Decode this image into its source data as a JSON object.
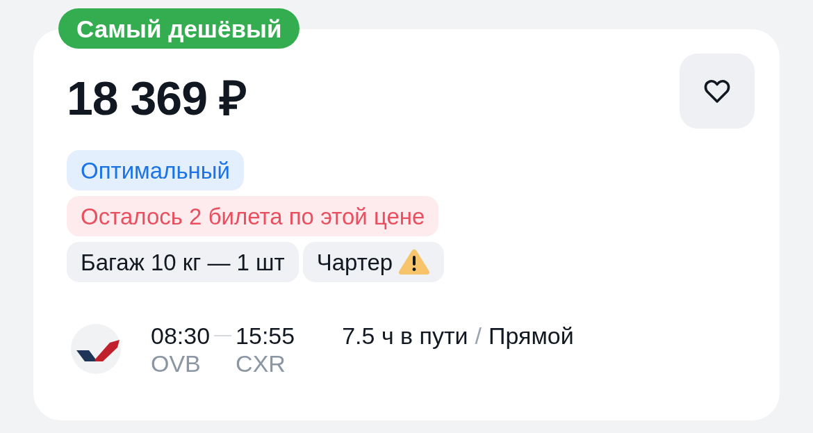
{
  "badge": {
    "text": "Самый дешёвый"
  },
  "price": "18 369 ₽",
  "favorite_button": {
    "favorited": false
  },
  "tag_rows": [
    [
      {
        "kind": "info",
        "text": "Оптимальный"
      }
    ],
    [
      {
        "kind": "alert",
        "text": "Осталось 2 билета по этой цене"
      }
    ],
    [
      {
        "kind": "neutral",
        "text": "Багаж 10 кг — 1 шт",
        "warning": false
      },
      {
        "kind": "neutral",
        "text": "Чартер",
        "warning": true
      }
    ]
  ],
  "flight": {
    "departure": {
      "time": "08:30",
      "airport": "OVB"
    },
    "arrival": {
      "time": "15:55",
      "airport": "CXR"
    },
    "duration": "7.5 ч в пути",
    "separator": "/",
    "stops": "Прямой"
  }
}
